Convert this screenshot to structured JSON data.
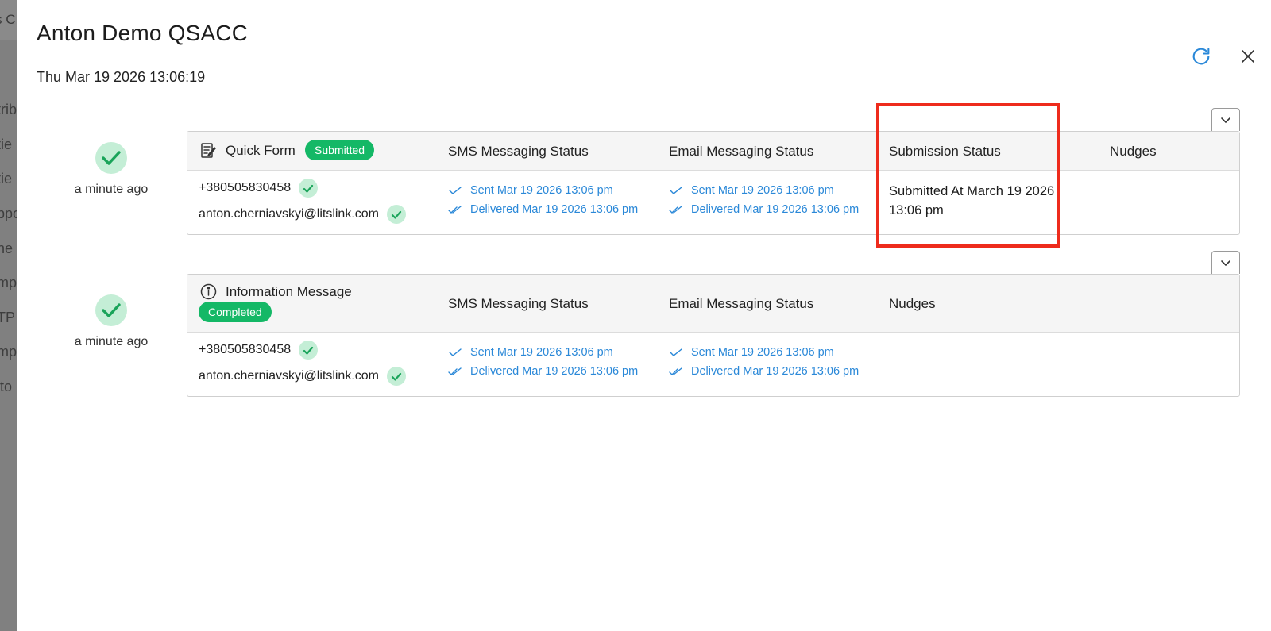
{
  "background": {
    "top_field_text": "s C",
    "side_fragments": [
      "trib",
      "tie",
      "tie",
      "ppo",
      "ne",
      "mp",
      "TP",
      "mp",
      "ito"
    ]
  },
  "modal": {
    "title": "Anton Demo QSACC",
    "date": "Thu Mar 19 2026 13:06:19",
    "refresh_icon": "refresh-icon",
    "close_icon": "close-icon"
  },
  "colors": {
    "accent": "#2a88d8",
    "badge_green": "#14b866",
    "check_bg": "#c4eed6",
    "check_green": "#1aa45a",
    "highlight": "#ee2b1c"
  },
  "entries": [
    {
      "time_ago": "a minute ago",
      "type_icon": "form-edit-icon",
      "name": "Quick Form",
      "badge": "Submitted",
      "columns": {
        "sms": "SMS Messaging Status",
        "email": "Email Messaging Status",
        "submission": "Submission Status",
        "nudges": "Nudges"
      },
      "phone": "+380505830458",
      "email": "anton.cherniavskyi@litslink.com",
      "sms_status": {
        "sent": "Sent Mar 19 2026 13:06 pm",
        "delivered": "Delivered Mar 19 2026 13:06 pm"
      },
      "email_status": {
        "sent": "Sent Mar 19 2026 13:06 pm",
        "delivered": "Delivered Mar 19 2026 13:06 pm"
      },
      "submission_status_line1": "Submitted At March 19 2026",
      "submission_status_line2": "13:06 pm"
    },
    {
      "time_ago": "a minute ago",
      "type_icon": "info-icon",
      "name": "Information Message",
      "badge": "Completed",
      "columns": {
        "sms": "SMS Messaging Status",
        "email": "Email Messaging Status",
        "nudges": "Nudges"
      },
      "phone": "+380505830458",
      "email": "anton.cherniavskyi@litslink.com",
      "sms_status": {
        "sent": "Sent Mar 19 2026 13:06 pm",
        "delivered": "Delivered Mar 19 2026 13:06 pm"
      },
      "email_status": {
        "sent": "Sent Mar 19 2026 13:06 pm",
        "delivered": "Delivered Mar 19 2026 13:06 pm"
      }
    }
  ]
}
